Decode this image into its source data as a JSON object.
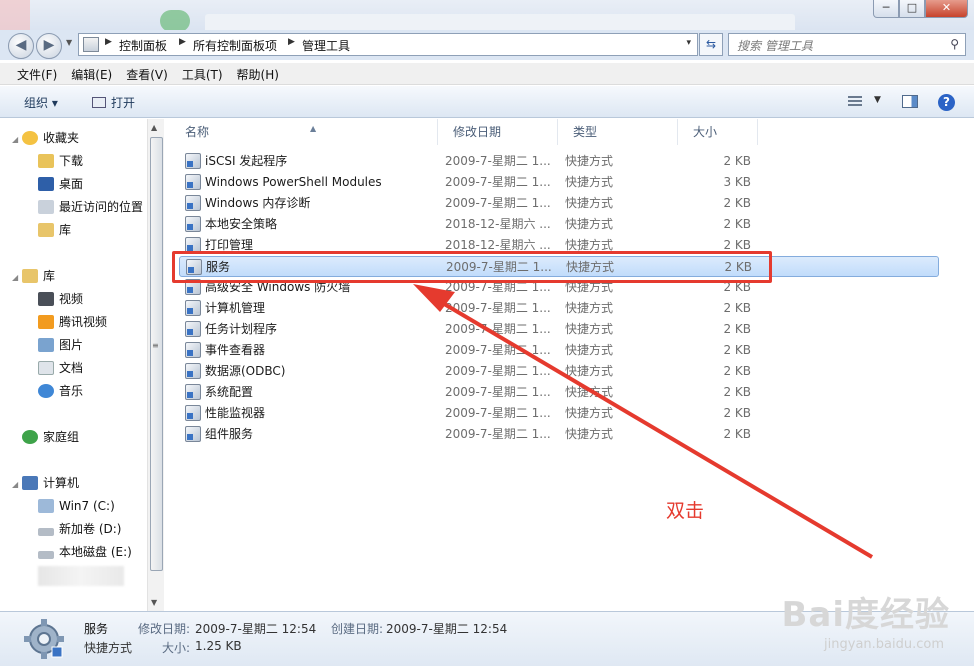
{
  "window": {
    "controls": {
      "minimize": "─",
      "maximize": "□",
      "close": "✕"
    }
  },
  "address": {
    "crumbs": [
      "控制面板",
      "所有控制面板项",
      "管理工具"
    ],
    "dropdown": "▾"
  },
  "search": {
    "placeholder": "搜索 管理工具"
  },
  "menu": [
    "文件(F)",
    "编辑(E)",
    "查看(V)",
    "工具(T)",
    "帮助(H)"
  ],
  "toolbar": {
    "organize": "组织 ▾",
    "open": "打开"
  },
  "nav": {
    "favorites": "收藏夹",
    "downloads": "下载",
    "desktop": "桌面",
    "recent": "最近访问的位置",
    "library_fav": "库",
    "libraries": "库",
    "videos": "视频",
    "tencent_video": "腾讯视频",
    "pictures": "图片",
    "documents": "文档",
    "music": "音乐",
    "homegroup": "家庭组",
    "computer": "计算机",
    "drive_c": "Win7 (C:)",
    "drive_d": "新加卷 (D:)",
    "drive_e": "本地磁盘 (E:)"
  },
  "columns": {
    "name": "名称",
    "date": "修改日期",
    "type": "类型",
    "size": "大小"
  },
  "files": [
    {
      "name": "iSCSI 发起程序",
      "date": "2009-7-星期二 1...",
      "type": "快捷方式",
      "size": "2 KB"
    },
    {
      "name": "Windows PowerShell Modules",
      "date": "2009-7-星期二 1...",
      "type": "快捷方式",
      "size": "3 KB"
    },
    {
      "name": "Windows 内存诊断",
      "date": "2009-7-星期二 1...",
      "type": "快捷方式",
      "size": "2 KB"
    },
    {
      "name": "本地安全策略",
      "date": "2018-12-星期六 ...",
      "type": "快捷方式",
      "size": "2 KB"
    },
    {
      "name": "打印管理",
      "date": "2018-12-星期六 ...",
      "type": "快捷方式",
      "size": "2 KB"
    },
    {
      "name": "服务",
      "date": "2009-7-星期二 1...",
      "type": "快捷方式",
      "size": "2 KB"
    },
    {
      "name": "高级安全 Windows 防火墙",
      "date": "2009-7-星期二 1...",
      "type": "快捷方式",
      "size": "2 KB"
    },
    {
      "name": "计算机管理",
      "date": "2009-7-星期二 1...",
      "type": "快捷方式",
      "size": "2 KB"
    },
    {
      "name": "任务计划程序",
      "date": "2009-7-星期二 1...",
      "type": "快捷方式",
      "size": "2 KB"
    },
    {
      "name": "事件查看器",
      "date": "2009-7-星期二 1...",
      "type": "快捷方式",
      "size": "2 KB"
    },
    {
      "name": "数据源(ODBC)",
      "date": "2009-7-星期二 1...",
      "type": "快捷方式",
      "size": "2 KB"
    },
    {
      "name": "系统配置",
      "date": "2009-7-星期二 1...",
      "type": "快捷方式",
      "size": "2 KB"
    },
    {
      "name": "性能监视器",
      "date": "2009-7-星期二 1...",
      "type": "快捷方式",
      "size": "2 KB"
    },
    {
      "name": "组件服务",
      "date": "2009-7-星期二 1...",
      "type": "快捷方式",
      "size": "2 KB"
    }
  ],
  "selected_index": 5,
  "annotation": {
    "text": "双击",
    "color": "#e53a2e"
  },
  "details": {
    "name": "服务",
    "type": "快捷方式",
    "modified_label": "修改日期:",
    "modified_value": "2009-7-星期二 12:54",
    "created_label": "创建日期:",
    "created_value": "2009-7-星期二 12:54",
    "size_label": "大小:",
    "size_value": "1.25 KB"
  },
  "watermark": {
    "main": "Bai度经验",
    "sub": "jingyan.baidu.com"
  }
}
